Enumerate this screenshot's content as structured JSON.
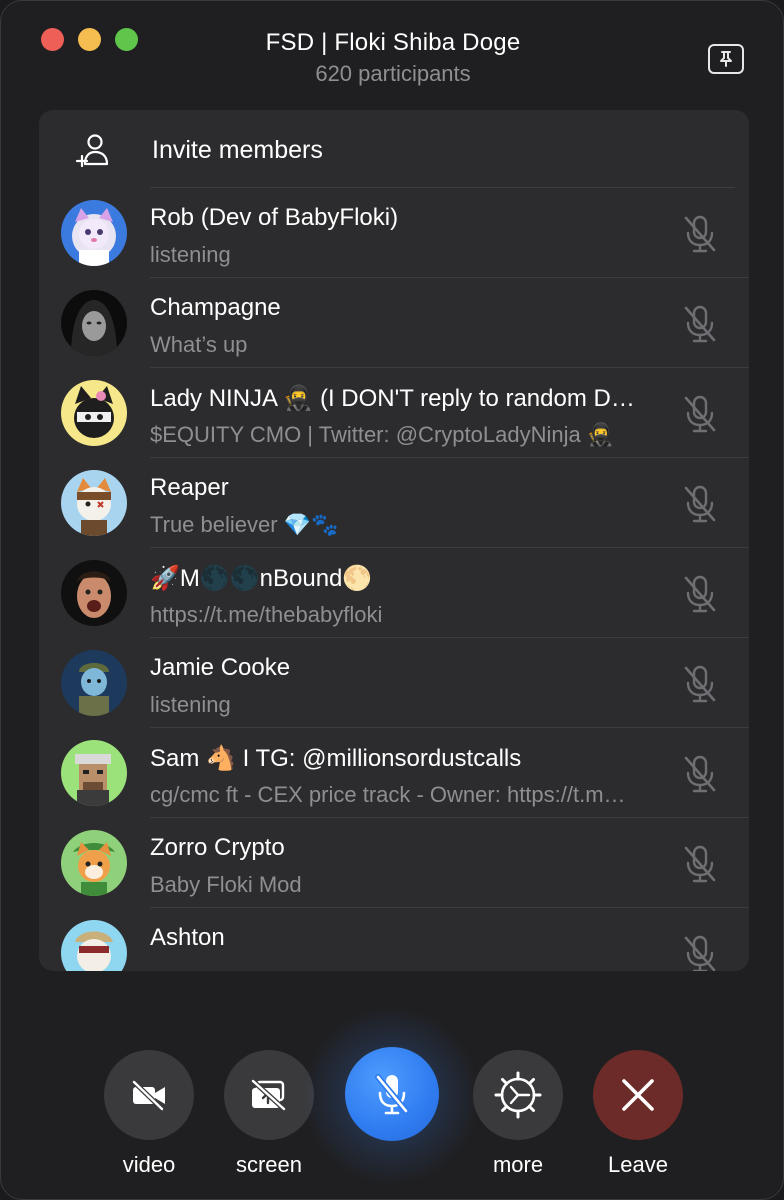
{
  "window": {
    "title": "FSD | Floki Shiba Doge",
    "subtitle": "620 participants"
  },
  "invite": {
    "label": "Invite members"
  },
  "participants": [
    {
      "name": "Rob (Dev of BabyFloki)",
      "status": "listening",
      "muted": true
    },
    {
      "name": "Champagne",
      "status": "What’s up",
      "muted": true
    },
    {
      "name": "Lady NINJA 🥷  (I DON'T reply to random D…",
      "status": "$EQUITY CMO | Twitter: @CryptoLadyNinja 🥷",
      "muted": true
    },
    {
      "name": "Reaper",
      "status": "True believer 💎🐾",
      "muted": true
    },
    {
      "name": "🚀M🌑🌑nBound🌕",
      "status": "https://t.me/thebabyfloki",
      "muted": true
    },
    {
      "name": "Jamie Cooke",
      "status": "listening",
      "muted": true
    },
    {
      "name": "Sam 🐴 I TG: @millionsordustcalls",
      "status": "cg/cmc ft - CEX price track - Owner: https://t.m…",
      "muted": true
    },
    {
      "name": "Zorro Crypto",
      "status": "Baby Floki Mod",
      "muted": true
    },
    {
      "name": "Ashton",
      "status": "",
      "muted": true
    }
  ],
  "controls": {
    "video_label": "video",
    "screen_label": "screen",
    "more_label": "more",
    "leave_label": "Leave"
  },
  "colors": {
    "accent": "#2f7cf0",
    "leave": "#6c2b28",
    "panel": "#2c2c2e",
    "secondary_text": "#8e8e93"
  }
}
